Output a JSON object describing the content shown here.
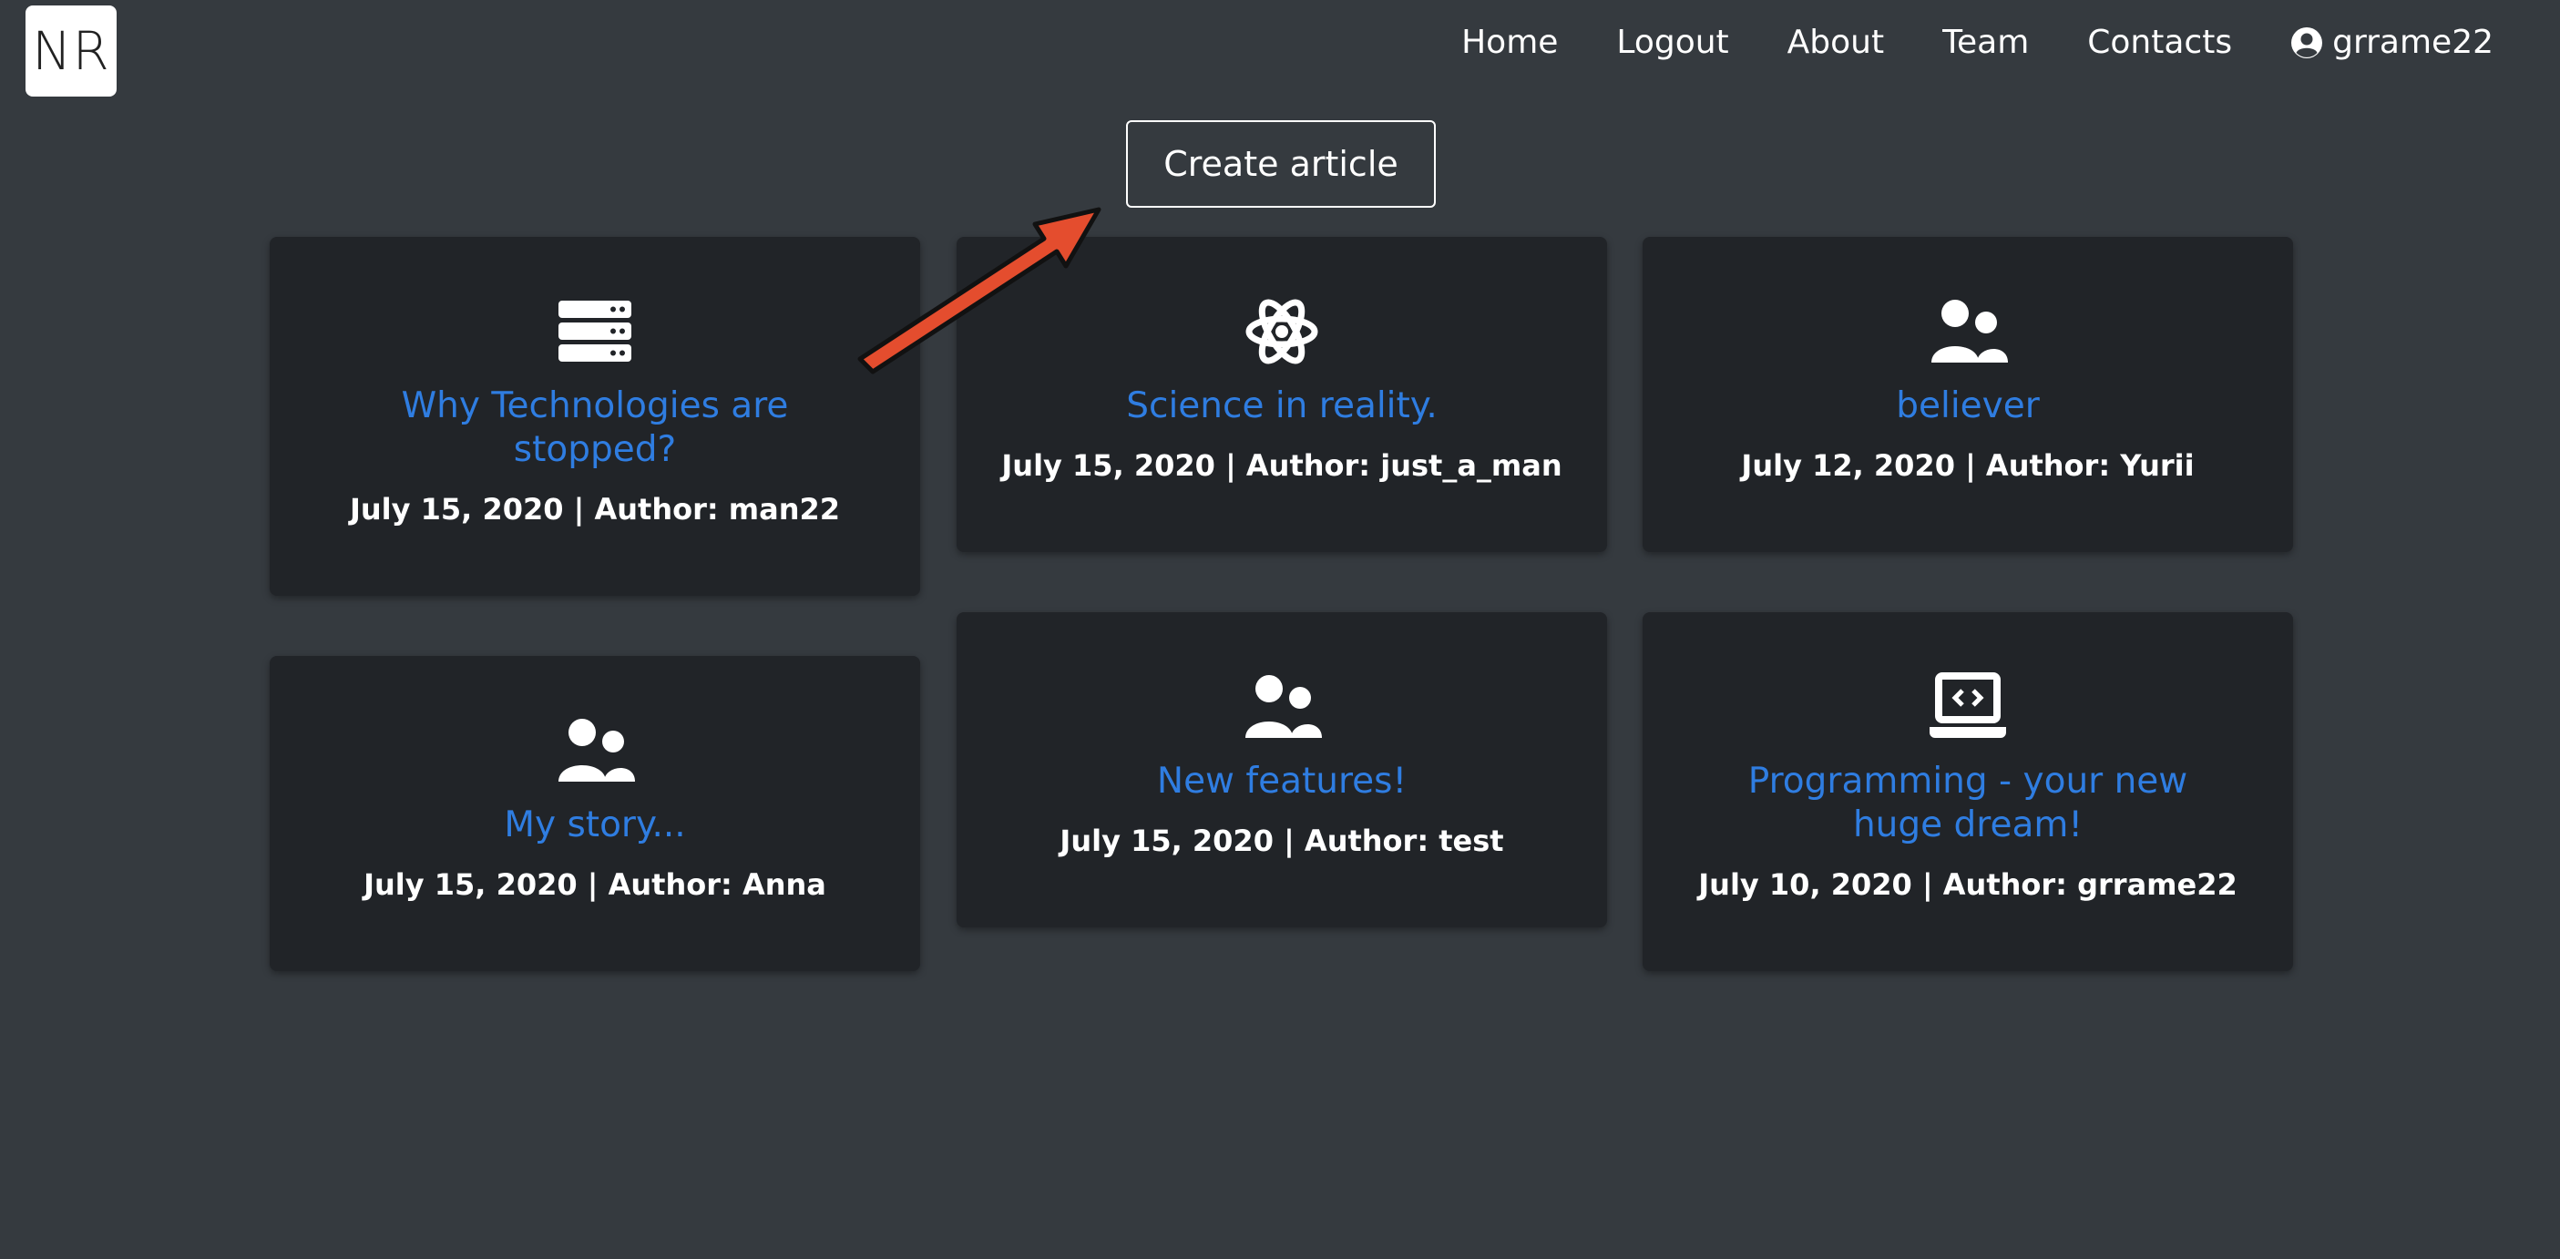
{
  "logo": {
    "text": "NR"
  },
  "nav": {
    "items": [
      "Home",
      "Logout",
      "About",
      "Team",
      "Contacts"
    ],
    "user": "grrame22"
  },
  "create_button": {
    "label": "Create article"
  },
  "annotation": {
    "arrow_color": "#e44d2e"
  },
  "articles": [
    {
      "icon": "server-icon",
      "title": "Why Technologies are stopped?",
      "meta": "July 15, 2020 | Author: man22"
    },
    {
      "icon": "atom-icon",
      "title": "Science in reality.",
      "meta": "July 15, 2020 | Author: just_a_man"
    },
    {
      "icon": "users-icon",
      "title": "believer",
      "meta": "July 12, 2020 | Author: Yurii"
    },
    {
      "icon": "users-icon",
      "title": "My story...",
      "meta": "July 15, 2020 | Author: Anna"
    },
    {
      "icon": "users-icon",
      "title": "New features!",
      "meta": "July 15, 2020 | Author: test"
    },
    {
      "icon": "laptop-code-icon",
      "title": "Programming - your new huge dream!",
      "meta": "July 10, 2020 | Author: grrame22"
    }
  ],
  "colors": {
    "background": "#353a3f",
    "card": "#212428",
    "link": "#2f7de1"
  }
}
